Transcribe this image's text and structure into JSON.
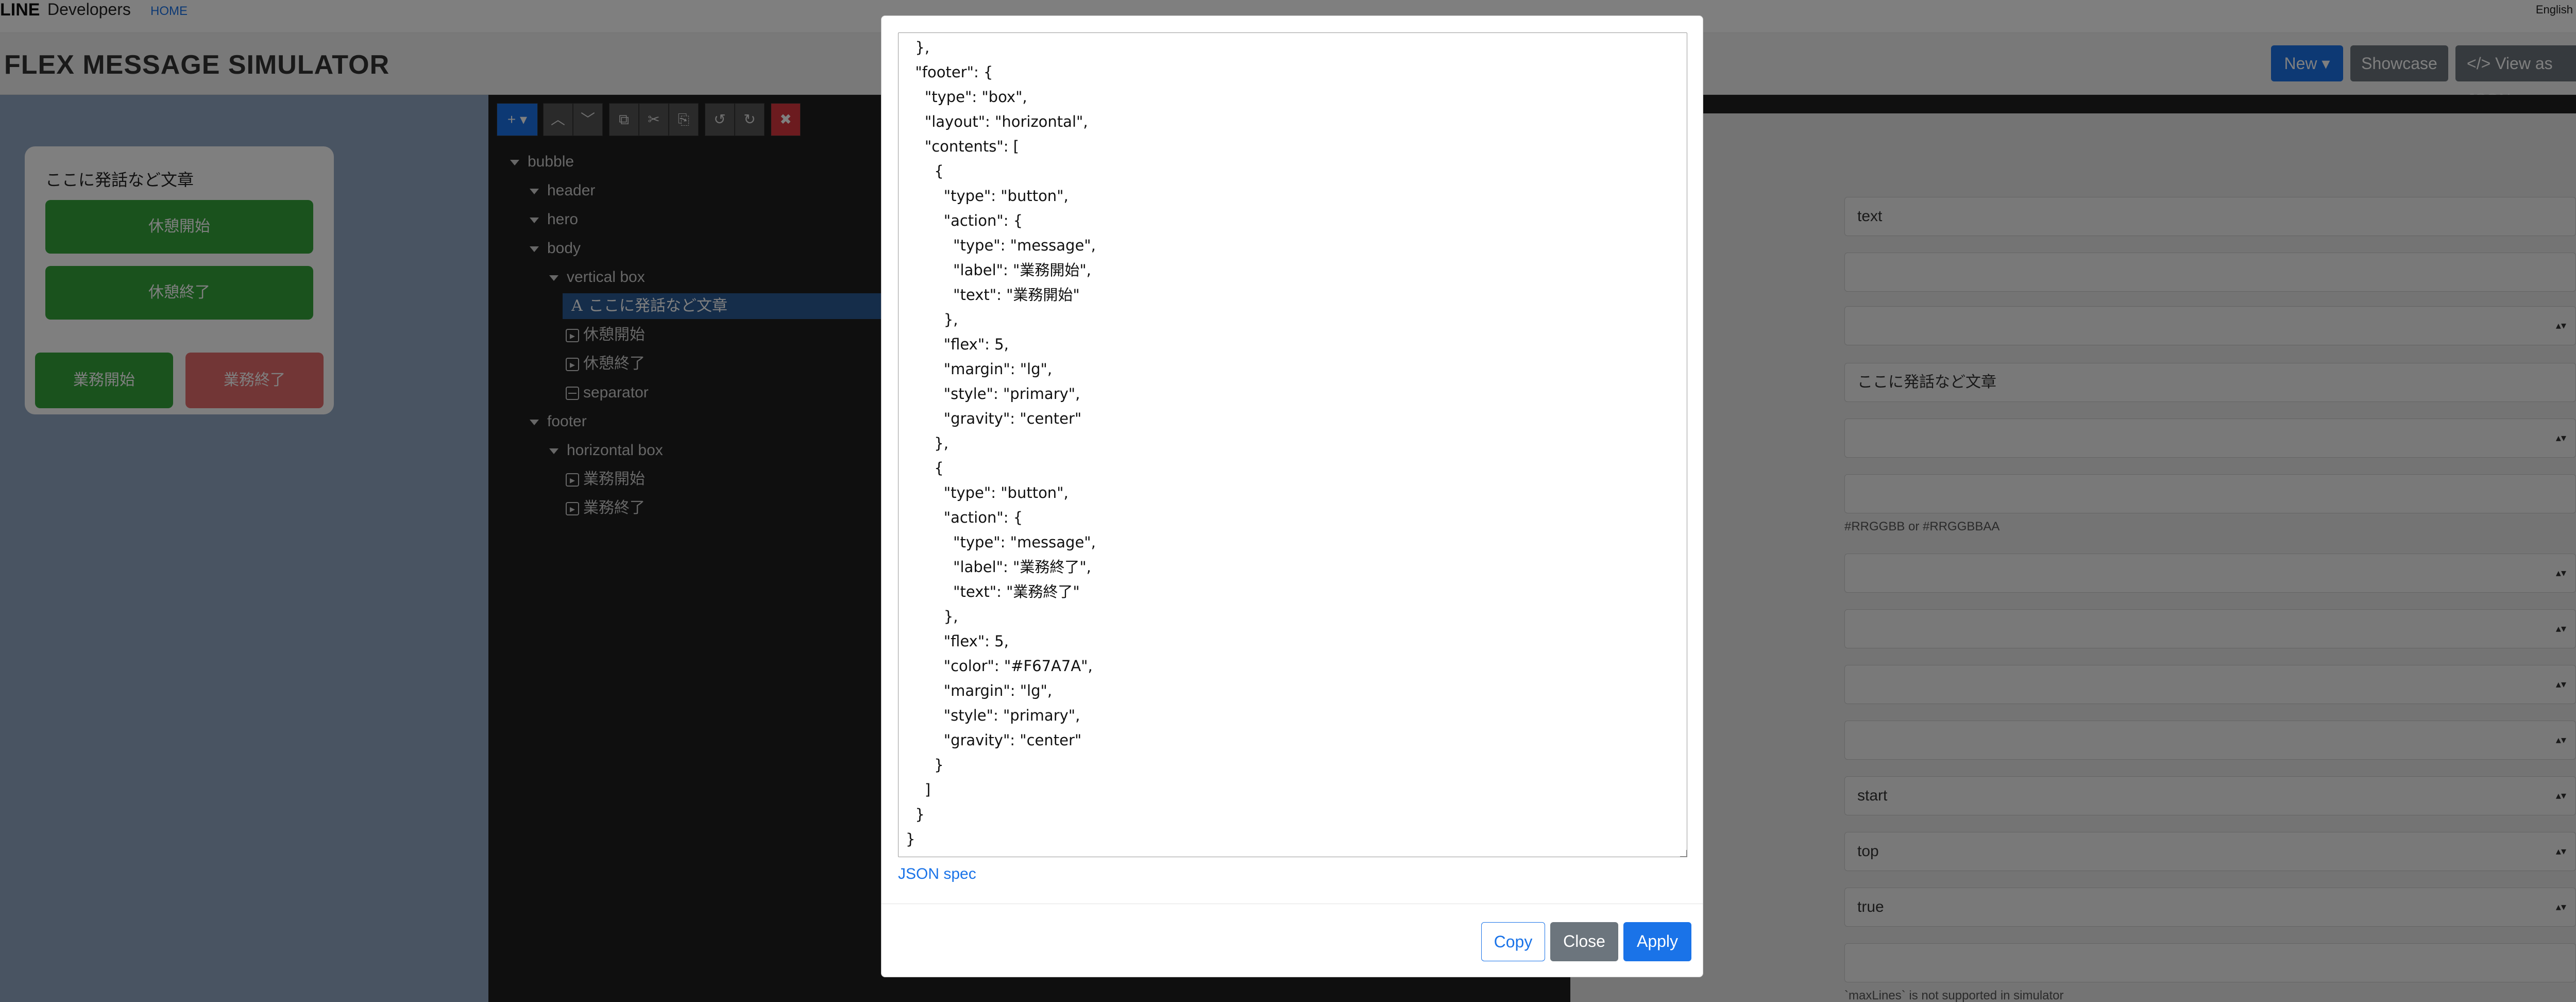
{
  "nav": {
    "logo": "LINE",
    "brand_sub": "Developers",
    "home": "HOME",
    "language": "English"
  },
  "header": {
    "title": "FLEX MESSAGE SIMULATOR",
    "new_label": "New ▾",
    "showcase_label": "Showcase",
    "view_json_label": "</> View as JSON"
  },
  "preview": {
    "message_text": "ここに発話など文章",
    "btn_break_start": "休憩開始",
    "btn_break_end": "休憩終了",
    "btn_work_start": "業務開始",
    "btn_work_end": "業務終了",
    "colors": {
      "green": "#34a43b",
      "red": "#e46c6c"
    }
  },
  "toolbar": {
    "add": "+ ▾",
    "up": "︿",
    "down": "﹀",
    "copy": "⧉",
    "cut": "✂",
    "paste": "⎘",
    "undo": "↺",
    "redo": "↻",
    "delete": "✖"
  },
  "tree": {
    "bubble": "bubble",
    "header": "header",
    "hero": "hero",
    "body": "body",
    "vertical_box": "vertical box",
    "text_item": "ここに発話など文章",
    "button1": "休憩開始",
    "button2": "休憩終了",
    "separator": "separator",
    "footer": "footer",
    "horizontal_box": "horizontal box",
    "button3": "業務開始",
    "button4": "業務終了"
  },
  "props": {
    "type_value": "text",
    "text_value": "ここに発話など文章",
    "color_help": "#RRGGBB or #RRGGBBAA",
    "align_value": "start",
    "gravity_value": "top",
    "wrap_value": "true",
    "maxlines_help": "`maxLines` is not supported in simulator"
  },
  "modal": {
    "json_lines": [
      "  },",
      "  \"footer\": {",
      "    \"type\": \"box\",",
      "    \"layout\": \"horizontal\",",
      "    \"contents\": [",
      "      {",
      "        \"type\": \"button\",",
      "        \"action\": {",
      "          \"type\": \"message\",",
      "          \"label\": \"業務開始\",",
      "          \"text\": \"業務開始\"",
      "        },",
      "        \"flex\": 5,",
      "        \"margin\": \"lg\",",
      "        \"style\": \"primary\",",
      "        \"gravity\": \"center\"",
      "      },",
      "      {",
      "        \"type\": \"button\",",
      "        \"action\": {",
      "          \"type\": \"message\",",
      "          \"label\": \"業務終了\",",
      "          \"text\": \"業務終了\"",
      "        },",
      "        \"flex\": 5,",
      "        \"color\": \"#F67A7A\",",
      "        \"margin\": \"lg\",",
      "        \"style\": \"primary\",",
      "        \"gravity\": \"center\"",
      "      }",
      "    ]",
      "  }",
      "}"
    ],
    "spec_link": "JSON spec",
    "copy_label": "Copy",
    "close_label": "Close",
    "apply_label": "Apply"
  }
}
